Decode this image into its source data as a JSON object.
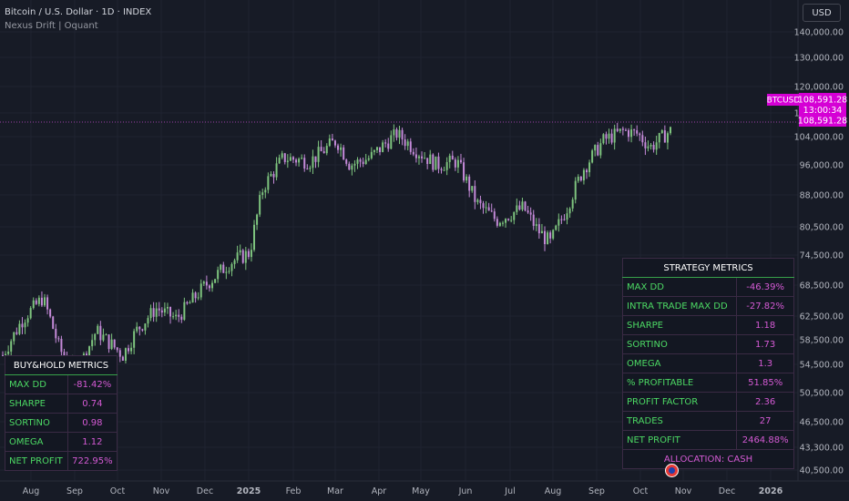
{
  "header": {
    "symbol_title": "Bitcoin / U.S. Dollar · 1D · INDEX",
    "indicator_name": "Nexus Drift | Oquant",
    "currency_button": "USD"
  },
  "price_axis": {
    "ticks": [
      {
        "label": "140,000.00",
        "value": 140000
      },
      {
        "label": "130,000.00",
        "value": 130000
      },
      {
        "label": "120,000.00",
        "value": 120000
      },
      {
        "label": "112,000.00",
        "value": 112000
      },
      {
        "label": "104,000.00",
        "value": 104000
      },
      {
        "label": "96,000.00",
        "value": 96000
      },
      {
        "label": "88,000.00",
        "value": 88000
      },
      {
        "label": "80,500.00",
        "value": 80500
      },
      {
        "label": "74,500.00",
        "value": 74500
      },
      {
        "label": "68,500.00",
        "value": 68500
      },
      {
        "label": "62,500.00",
        "value": 62500
      },
      {
        "label": "58,500.00",
        "value": 58500
      },
      {
        "label": "54,500.00",
        "value": 54500
      },
      {
        "label": "50,500.00",
        "value": 50500
      },
      {
        "label": "46,500.00",
        "value": 46500
      },
      {
        "label": "43,300.00",
        "value": 43300
      },
      {
        "label": "40,500.00",
        "value": 40500
      }
    ],
    "last_price": "108,591.28",
    "last_price_value": 108591.28,
    "symbol_tag": "BTCUSD",
    "countdown": "13:00:34",
    "tag_color": "#d500d5"
  },
  "time_axis": [
    {
      "label": "Aug",
      "bold": false
    },
    {
      "label": "Sep",
      "bold": false
    },
    {
      "label": "Oct",
      "bold": false
    },
    {
      "label": "Nov",
      "bold": false
    },
    {
      "label": "Dec",
      "bold": false
    },
    {
      "label": "2025",
      "bold": true
    },
    {
      "label": "Feb",
      "bold": false
    },
    {
      "label": "Mar",
      "bold": false
    },
    {
      "label": "Apr",
      "bold": false
    },
    {
      "label": "May",
      "bold": false
    },
    {
      "label": "Jun",
      "bold": false
    },
    {
      "label": "Jul",
      "bold": false
    },
    {
      "label": "Aug",
      "bold": false
    },
    {
      "label": "Sep",
      "bold": false
    },
    {
      "label": "Oct",
      "bold": false
    },
    {
      "label": "Nov",
      "bold": false
    },
    {
      "label": "Dec",
      "bold": false
    },
    {
      "label": "2026",
      "bold": true
    }
  ],
  "colors": {
    "bull": "#7ec47e",
    "bear": "#c48ad8",
    "pane_bg": "#171b26",
    "table_border": "#37a14a",
    "metric_key": "#4cd964",
    "metric_value": "#d45ad4"
  },
  "buyhold_table": {
    "title": "BUY&HOLD METRICS",
    "rows": [
      {
        "label": "MAX DD",
        "value": "-81.42%"
      },
      {
        "label": "SHARPE",
        "value": "0.74"
      },
      {
        "label": "SORTINO",
        "value": "0.98"
      },
      {
        "label": "OMEGA",
        "value": "1.12"
      },
      {
        "label": "NET PROFIT",
        "value": "722.95%"
      }
    ]
  },
  "strategy_table": {
    "title": "STRATEGY METRICS",
    "rows": [
      {
        "label": "MAX DD",
        "value": "-46.39%"
      },
      {
        "label": "INTRA TRADE MAX DD",
        "value": "-27.82%"
      },
      {
        "label": "SHARPE",
        "value": "1.18"
      },
      {
        "label": "SORTINO",
        "value": "1.73"
      },
      {
        "label": "OMEGA",
        "value": "1.3"
      },
      {
        "label": "% PROFITABLE",
        "value": "51.85%"
      },
      {
        "label": "PROFIT FACTOR",
        "value": "2.36"
      },
      {
        "label": "TRADES",
        "value": "27"
      },
      {
        "label": "NET PROFIT",
        "value": "2464.88%"
      }
    ],
    "allocation": "ALLOCATION: CASH"
  },
  "chart_data": {
    "type": "candlestick",
    "price_anchors": [
      [
        0,
        56000
      ],
      [
        0.03,
        62000
      ],
      [
        0.06,
        66000
      ],
      [
        0.085,
        57000
      ],
      [
        0.11,
        53000
      ],
      [
        0.14,
        60000
      ],
      [
        0.18,
        56000
      ],
      [
        0.2,
        60000
      ],
      [
        0.23,
        64000
      ],
      [
        0.26,
        62000
      ],
      [
        0.3,
        68000
      ],
      [
        0.34,
        73000
      ],
      [
        0.37,
        75000
      ],
      [
        0.39,
        90000
      ],
      [
        0.42,
        98000
      ],
      [
        0.46,
        97000
      ],
      [
        0.5,
        103000
      ],
      [
        0.52,
        96000
      ],
      [
        0.55,
        98000
      ],
      [
        0.59,
        105000
      ],
      [
        0.62,
        100000
      ],
      [
        0.65,
        96000
      ],
      [
        0.68,
        97000
      ],
      [
        0.71,
        86000
      ],
      [
        0.74,
        82000
      ],
      [
        0.78,
        85000
      ],
      [
        0.8,
        80000
      ],
      [
        0.82,
        77000
      ],
      [
        0.845,
        85000
      ],
      [
        0.87,
        95000
      ],
      [
        0.9,
        103000
      ],
      [
        0.93,
        106000
      ],
      [
        0.95,
        105000
      ],
      [
        0.97,
        101000
      ],
      [
        1.0,
        106000
      ]
    ]
  }
}
